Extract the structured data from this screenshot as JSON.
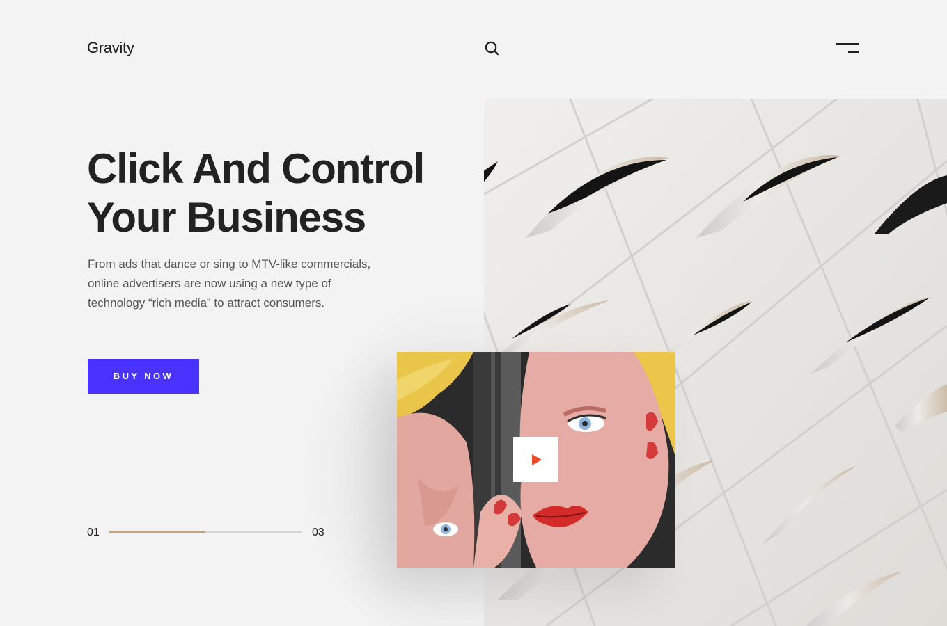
{
  "header": {
    "logo": "Gravity",
    "search_icon": "search-icon",
    "menu_icon": "hamburger-menu-icon"
  },
  "hero": {
    "title_line1": "Click And Control",
    "title_line2": "Your Business",
    "description_line1": "From ads that dance or sing to MTV-like commercials,",
    "description_line2": "online advertisers are now using a new type of",
    "description_line3": "technology “rich media” to attract consumers.",
    "cta_label": "BUY NOW"
  },
  "slider": {
    "current": "01",
    "total": "03",
    "progress": 0.5
  },
  "media": {
    "architecture_image": "architecture-photo",
    "video_thumbnail": "pop-art-mural-photo",
    "play_icon": "play-icon"
  },
  "colors": {
    "background": "#f3f3f3",
    "accent": "#4a32ff",
    "progress": "#c7a57a",
    "play": "#f0492b",
    "text": "#222222"
  }
}
